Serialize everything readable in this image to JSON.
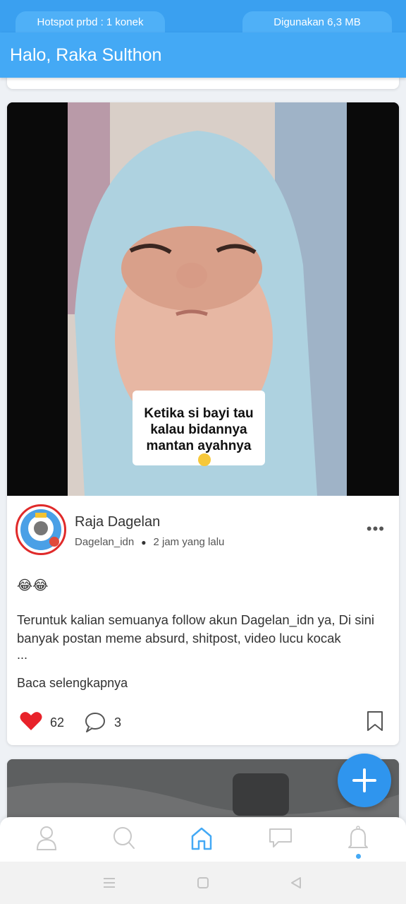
{
  "status": {
    "hotspot": "Hotspot prbd : 1 konek",
    "data_used": "Digunakan 6,3 MB"
  },
  "header": {
    "title": "Halo, Raka Sulthon"
  },
  "post": {
    "image_caption": "Ketika si bayi tau kalau bidannya mantan ayahnya",
    "author_name": "Raja Dagelan",
    "username": "Dagelan_idn",
    "time": "2 jam yang lalu",
    "emoji": "😂😂",
    "text": "Teruntuk kalian semuanya follow akun Dagelan_idn ya, Di sini banyak postan meme absurd, shitpost, video lucu kocak",
    "ellipsis": "...",
    "read_more": "Baca selengkapnya",
    "likes": "62",
    "comments": "3"
  },
  "bottom_nav": {
    "items": [
      "profile-icon",
      "search-icon",
      "home-icon",
      "chat-icon",
      "bell-icon"
    ],
    "active": "home-icon"
  },
  "colors": {
    "accent": "#44a9f5",
    "like": "#e8222a",
    "fab": "#2f95ee"
  }
}
